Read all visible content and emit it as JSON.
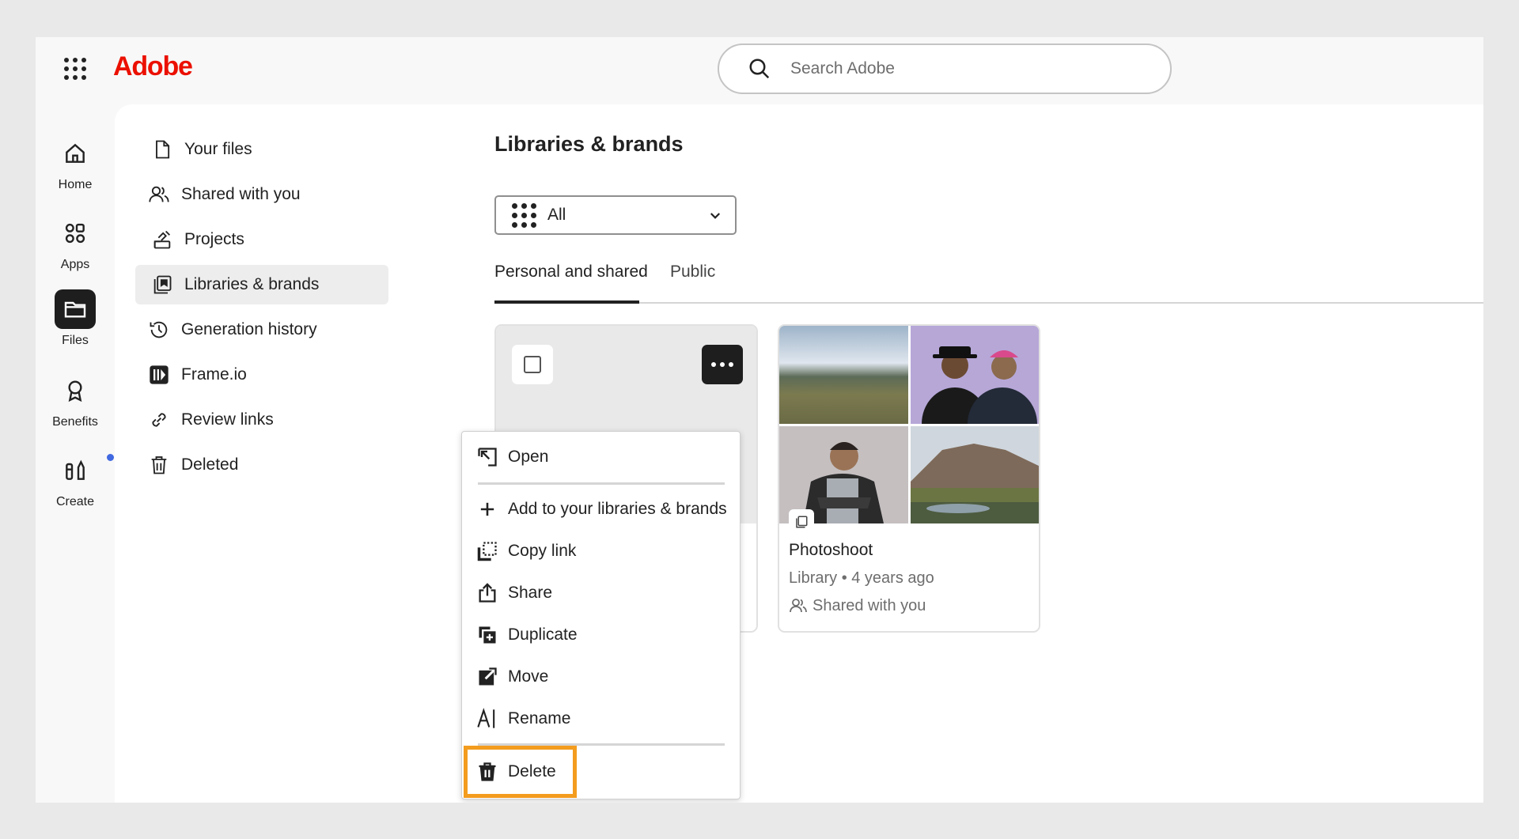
{
  "header": {
    "logo": "Adobe",
    "search_placeholder": "Search Adobe",
    "brand_color": "#eb1000"
  },
  "rail": {
    "items": [
      {
        "label": "Home",
        "icon": "home-icon"
      },
      {
        "label": "Apps",
        "icon": "apps-icon"
      },
      {
        "label": "Files",
        "icon": "folder-icon",
        "active": true
      },
      {
        "label": "Benefits",
        "icon": "award-icon"
      },
      {
        "label": "Create",
        "icon": "create-icon",
        "notification": true
      }
    ]
  },
  "sidebar": {
    "items": [
      {
        "label": "Your files",
        "icon": "file-icon"
      },
      {
        "label": "Shared with you",
        "icon": "users-icon"
      },
      {
        "label": "Projects",
        "icon": "projects-icon"
      },
      {
        "label": "Libraries & brands",
        "icon": "library-icon",
        "active": true
      },
      {
        "label": "Generation history",
        "icon": "history-icon"
      },
      {
        "label": "Frame.io",
        "icon": "frameio-icon"
      },
      {
        "label": "Review links",
        "icon": "link-icon"
      },
      {
        "label": "Deleted",
        "icon": "trash-icon"
      }
    ]
  },
  "main": {
    "title": "Libraries & brands",
    "filter_value": "All",
    "tabs": [
      {
        "label": "Personal and shared",
        "active": true
      },
      {
        "label": "Public",
        "active": false
      }
    ]
  },
  "cards": [
    {
      "title": "Photoshoot",
      "meta": "Library • 4 years ago",
      "shared": "Shared with you"
    }
  ],
  "context_menu": {
    "items": [
      {
        "label": "Open",
        "icon": "open-icon"
      },
      {
        "label": "Add to your libraries & brands",
        "icon": "plus-icon"
      },
      {
        "label": "Copy link",
        "icon": "copy-link-icon"
      },
      {
        "label": "Share",
        "icon": "share-icon"
      },
      {
        "label": "Duplicate",
        "icon": "duplicate-icon"
      },
      {
        "label": "Move",
        "icon": "move-icon"
      },
      {
        "label": "Rename",
        "icon": "rename-icon"
      },
      {
        "label": "Delete",
        "icon": "trash-icon",
        "highlighted": true
      }
    ],
    "highlight_color": "#f39c1e"
  }
}
